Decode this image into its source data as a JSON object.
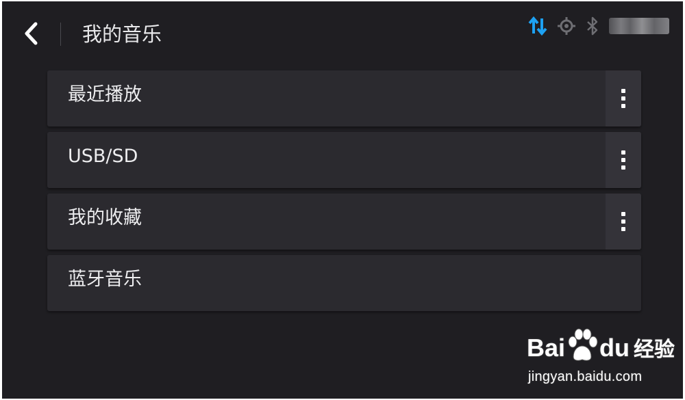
{
  "header": {
    "title": "我的音乐",
    "back_icon": "chevron-left-icon",
    "status_icons": [
      "data-transfer-icon",
      "location-target-icon",
      "bluetooth-icon"
    ],
    "accent_color": "#1da1f2"
  },
  "menu": {
    "items": [
      {
        "label": "最近播放",
        "has_more": true
      },
      {
        "label": "USB/SD",
        "has_more": true
      },
      {
        "label": "我的收藏",
        "has_more": true
      },
      {
        "label": "蓝牙音乐",
        "has_more": false
      }
    ],
    "more_icon": "more-vertical-icon"
  },
  "watermark": {
    "brand_left": "Bai",
    "brand_right": "du",
    "brand_suffix": "经验",
    "url": "jingyan.baidu.com"
  }
}
